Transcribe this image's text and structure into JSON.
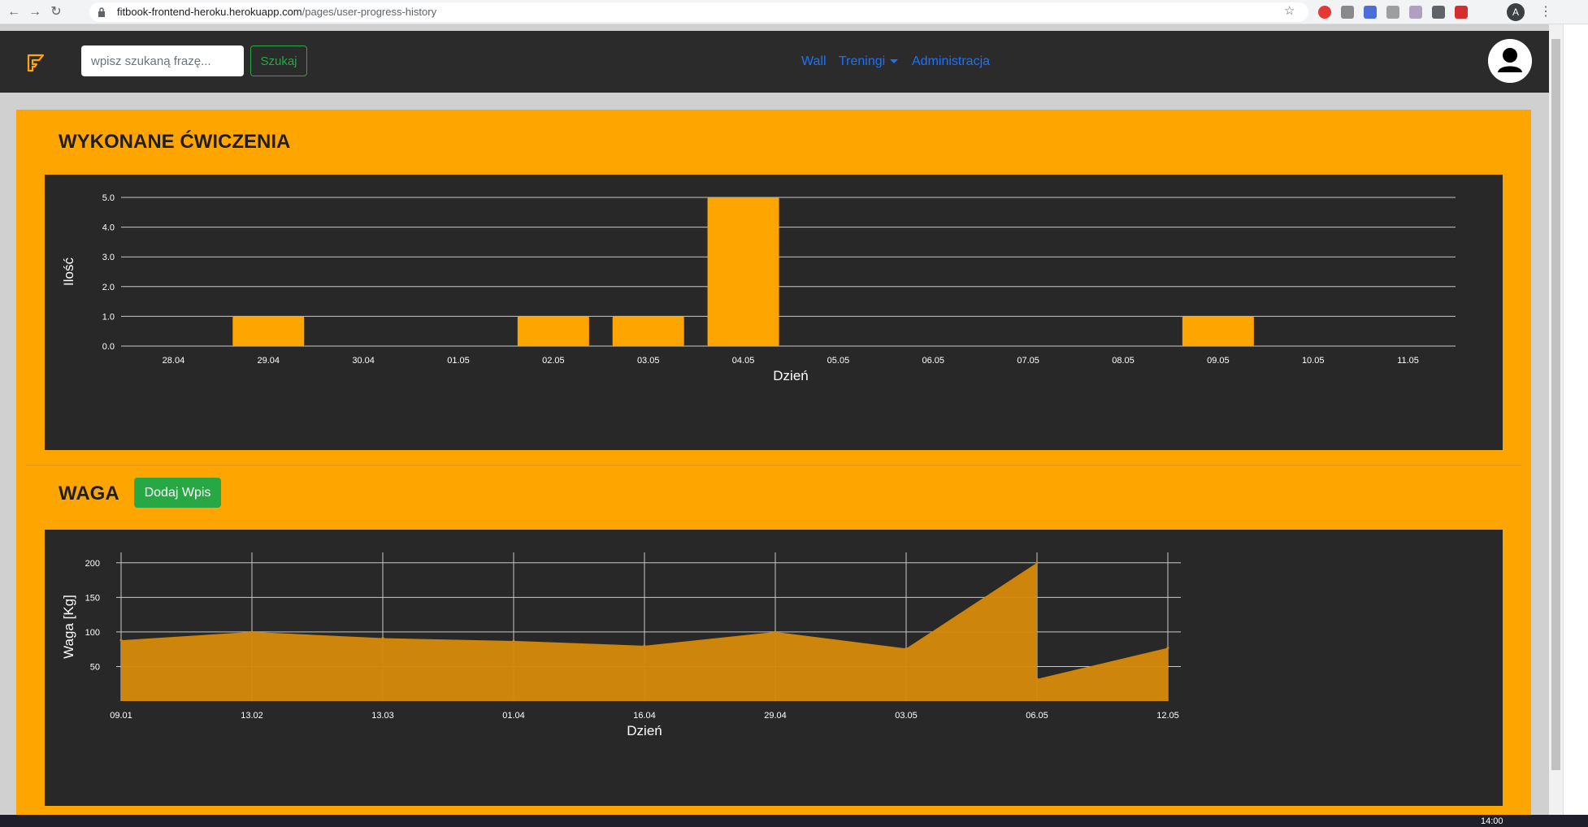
{
  "browser": {
    "url_host": "fitbook-frontend-heroku.herokuapp.com",
    "url_path": "/pages/user-progress-history",
    "profile_initial": "A"
  },
  "navbar": {
    "search_placeholder": "wpisz szukaną frazę...",
    "search_button": "Szukaj",
    "links": {
      "wall": "Wall",
      "trainings": "Treningi",
      "admin": "Administracja"
    }
  },
  "sections": {
    "exercises_title": "WYKONANE ĆWICZENIA",
    "weight_title": "WAGA",
    "add_entry_button": "Dodaj Wpis"
  },
  "taskbar": {
    "clock": "14:00"
  },
  "colors": {
    "accent": "#ffa500",
    "chart_bg": "#282828",
    "success": "#28a745",
    "link": "#1a73ff",
    "area_fill": "#d4880a"
  },
  "chart_data": [
    {
      "type": "bar",
      "categories": [
        "28.04",
        "29.04",
        "30.04",
        "01.05",
        "02.05",
        "03.05",
        "04.05",
        "05.05",
        "06.05",
        "07.05",
        "08.05",
        "09.05",
        "10.05",
        "11.05"
      ],
      "values": [
        0,
        1,
        0,
        0,
        1,
        1,
        5,
        0,
        0,
        0,
        0,
        1,
        0,
        0
      ],
      "xlabel": "Dzień",
      "ylabel": "Ilość",
      "ylim": [
        0,
        5
      ],
      "yticks": [
        "0.0",
        "1.0",
        "2.0",
        "3.0",
        "4.0",
        "5.0"
      ],
      "grid": true
    },
    {
      "type": "area",
      "x": [
        "09.01",
        "13.02",
        "13.03",
        "01.04",
        "16.04",
        "29.04",
        "03.05",
        "06.05",
        "06.05",
        "12.05"
      ],
      "values": [
        88,
        100,
        91,
        87,
        80,
        100,
        76,
        200,
        32,
        77
      ],
      "xticks": [
        "09.01",
        "13.02",
        "13.03",
        "01.04",
        "16.04",
        "29.04",
        "03.05",
        "06.05",
        "12.05"
      ],
      "xlabel": "Dzień",
      "ylabel": "Waga [Kg]",
      "ylim": [
        0,
        215
      ],
      "yticks": [
        "50",
        "100",
        "150",
        "200"
      ],
      "grid": true
    }
  ]
}
